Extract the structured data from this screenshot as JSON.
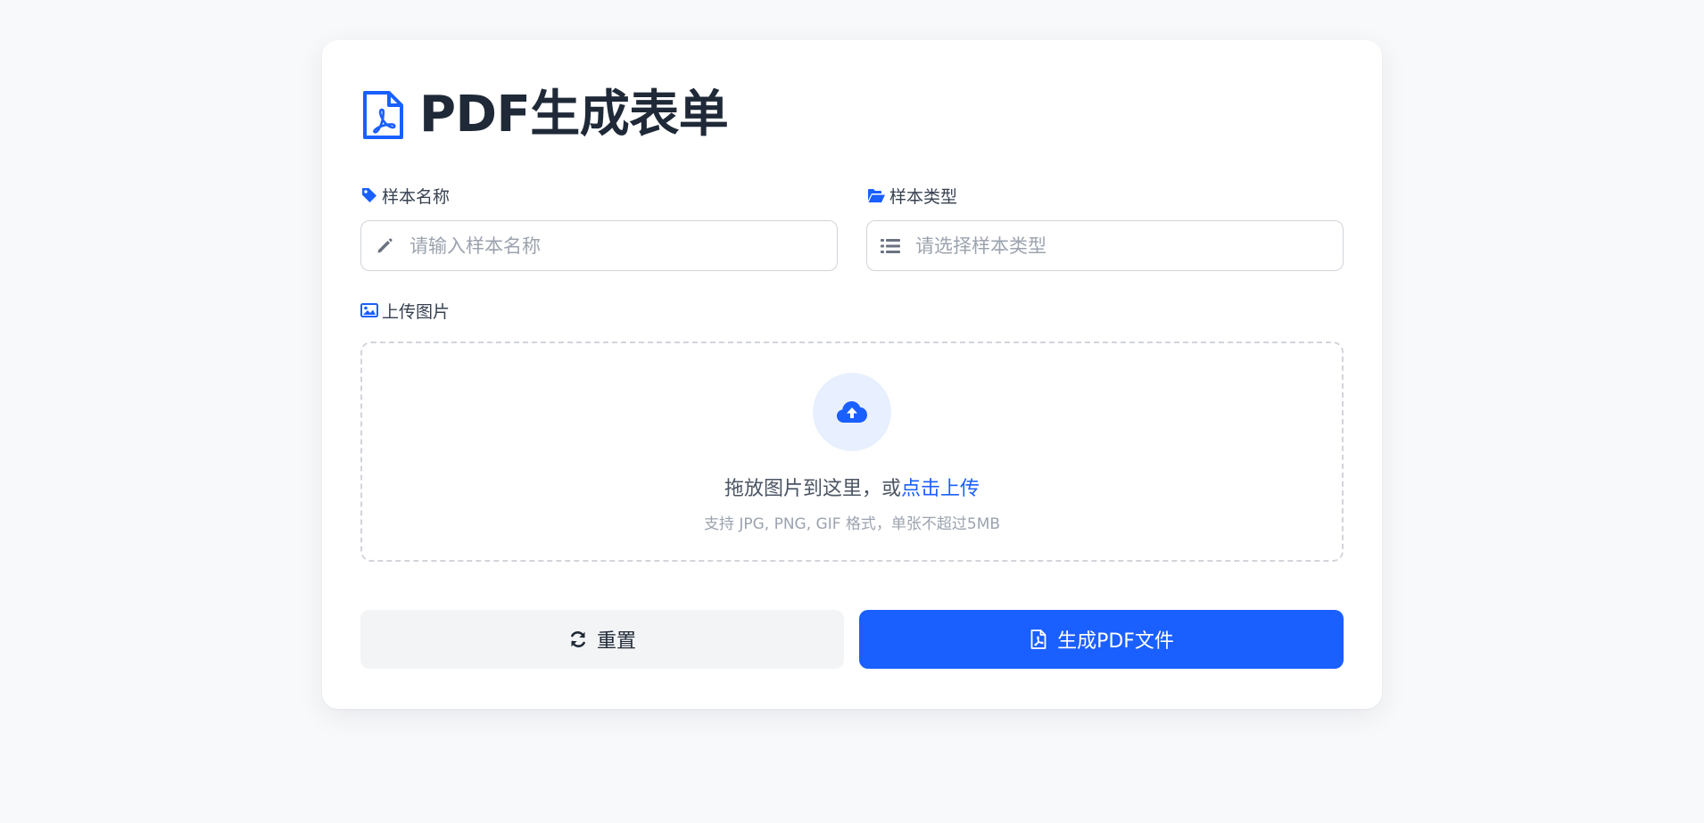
{
  "form": {
    "title": "PDF生成表单",
    "title_icon": "file-pdf-icon"
  },
  "fields": {
    "sample_name": {
      "label": "样本名称",
      "label_icon": "tag-icon",
      "input_icon": "pencil-icon",
      "placeholder": "请输入样本名称",
      "value": ""
    },
    "sample_type": {
      "label": "样本类型",
      "label_icon": "folder-open-icon",
      "input_icon": "list-icon",
      "placeholder": "请选择样本类型",
      "value": ""
    }
  },
  "upload": {
    "label": "上传图片",
    "label_icon": "image-icon",
    "zone_icon": "cloud-upload-icon",
    "prompt_text": "拖放图片到这里，或",
    "prompt_link": "点击上传",
    "hint": "支持 JPG, PNG, GIF 格式，单张不超过5MB"
  },
  "buttons": {
    "reset_label": "重置",
    "reset_icon": "sync-icon",
    "generate_label": "生成PDF文件",
    "generate_icon": "file-pdf-outline-icon"
  },
  "colors": {
    "accent": "#1a5fff",
    "page_bg": "#f8f9fb",
    "card_bg": "#ffffff",
    "reset_bg": "#f3f4f6",
    "upload_circle_bg": "#e8effe"
  }
}
